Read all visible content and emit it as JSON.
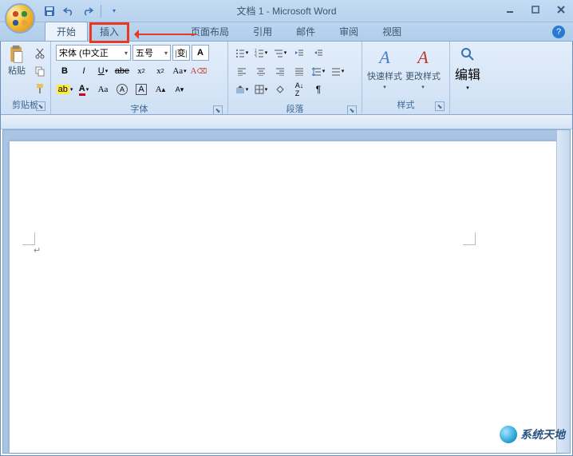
{
  "title": "文档 1 - Microsoft Word",
  "qat": {
    "save": "保存",
    "undo": "撤销",
    "redo": "重做"
  },
  "tabs": {
    "home": "开始",
    "insert": "插入",
    "layout": "页面布局",
    "references": "引用",
    "mailings": "邮件",
    "review": "审阅",
    "view": "视图"
  },
  "groups": {
    "clipboard": {
      "label": "剪贴板",
      "paste": "粘贴"
    },
    "font": {
      "label": "字体",
      "family": "宋体 (中文正",
      "size": "五号"
    },
    "paragraph": {
      "label": "段落"
    },
    "styles": {
      "label": "样式",
      "quick": "快速样式",
      "change": "更改样式"
    },
    "editing": {
      "label": "编辑"
    }
  },
  "watermark": "系统天地"
}
